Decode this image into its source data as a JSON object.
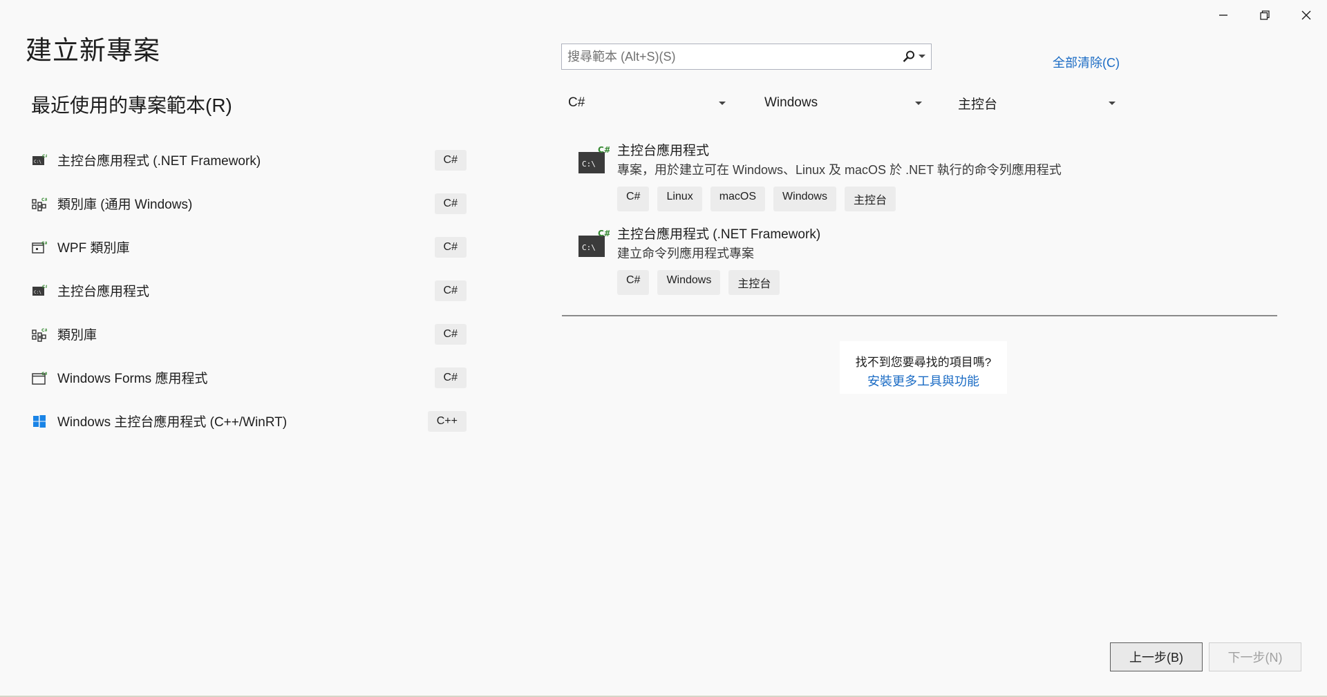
{
  "window": {
    "title": "建立新專案",
    "controls": [
      "minimize-icon",
      "restore-icon",
      "close-icon"
    ]
  },
  "recent": {
    "heading": "最近使用的專案範本(R)",
    "items": [
      {
        "label": "主控台應用程式 (.NET Framework)",
        "lang": "C#",
        "icon": "console-app-icon"
      },
      {
        "label": "類別庫 (通用 Windows)",
        "lang": "C#",
        "icon": "class-library-icon"
      },
      {
        "label": "WPF 類別庫",
        "lang": "C#",
        "icon": "wpf-library-icon"
      },
      {
        "label": "主控台應用程式",
        "lang": "C#",
        "icon": "console-app-icon"
      },
      {
        "label": "類別庫",
        "lang": "C#",
        "icon": "class-library-icon"
      },
      {
        "label": "Windows Forms 應用程式",
        "lang": "C#",
        "icon": "winforms-app-icon"
      },
      {
        "label": "Windows 主控台應用程式 (C++/WinRT)",
        "lang": "C++",
        "icon": "windows-logo-icon"
      }
    ]
  },
  "search": {
    "placeholder": "搜尋範本 (Alt+S)(S)",
    "value": ""
  },
  "clear_all": "全部清除(C)",
  "filters": {
    "language": "C#",
    "platform": "Windows",
    "project_type": "主控台"
  },
  "results": [
    {
      "title": "主控台應用程式",
      "description": "專案，用於建立可在 Windows、Linux 及 macOS 於 .NET 執行的命令列應用程式",
      "tags": [
        "C#",
        "Linux",
        "macOS",
        "Windows",
        "主控台"
      ]
    },
    {
      "title": "主控台應用程式 (.NET Framework)",
      "description": "建立命令列應用程式專案",
      "tags": [
        "C#",
        "Windows",
        "主控台"
      ]
    }
  ],
  "not_found": {
    "question": "找不到您要尋找的項目嗎?",
    "link": "安裝更多工具與功能"
  },
  "footer": {
    "back": "上一步(B)",
    "next": "下一步(N)"
  },
  "colors": {
    "link": "#1a6bc4",
    "background": "#f9f9f9",
    "tag_bg": "#ececec"
  }
}
